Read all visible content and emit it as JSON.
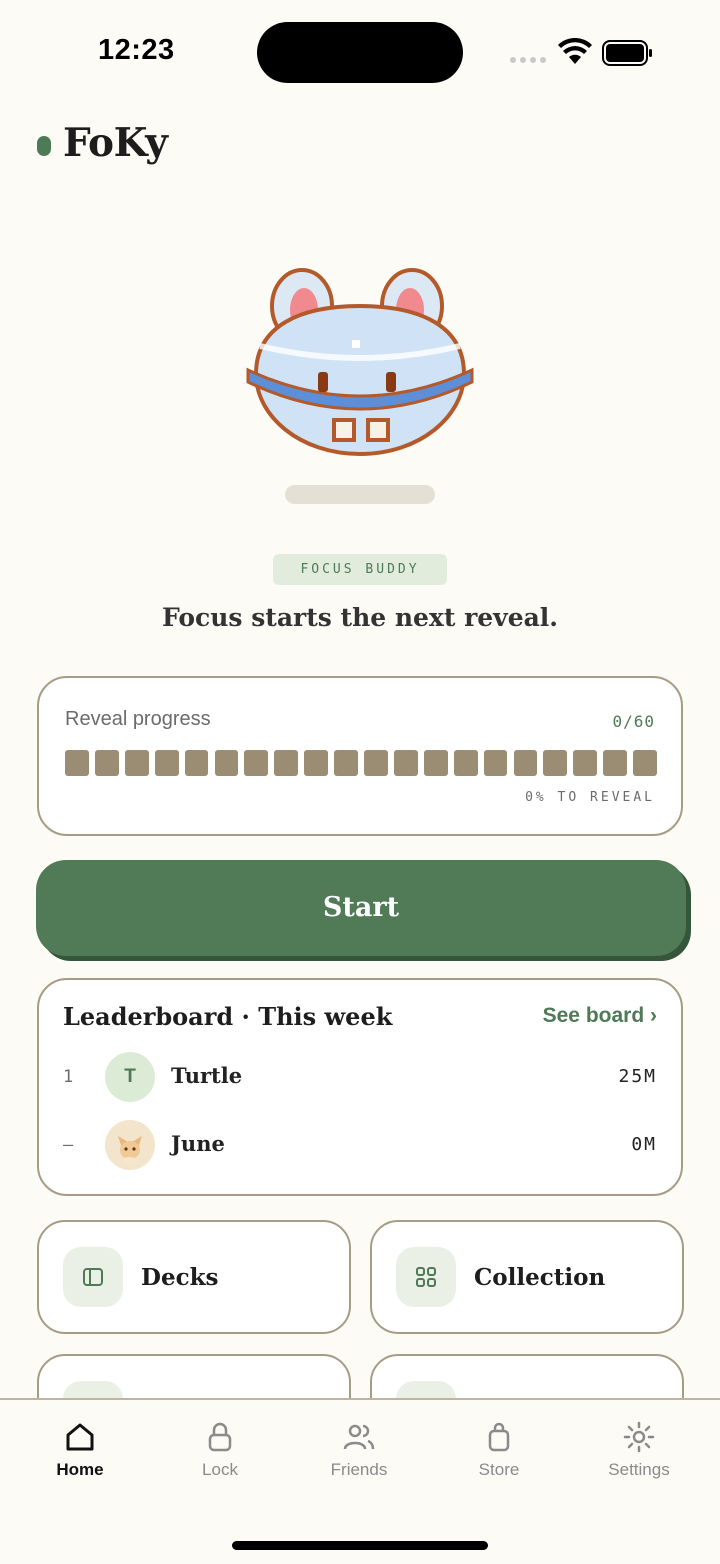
{
  "status_bar": {
    "time": "12:23"
  },
  "header": {
    "app_title": "FoKy"
  },
  "buddy": {
    "tag": "FOCUS BUDDY",
    "message": "Focus starts the next reveal."
  },
  "progress": {
    "label": "Reveal progress",
    "count": "0/60",
    "footer": "0% TO REVEAL",
    "segments_total": 20,
    "segments_filled": 0,
    "colors": {
      "empty": "#9A8D73"
    }
  },
  "start_button": {
    "label": "Start"
  },
  "leaderboard": {
    "title": "Leaderboard · This week",
    "link": "See board ›",
    "rows": [
      {
        "rank": "1",
        "avatar_letter": "T",
        "name": "Turtle",
        "minutes": "25M"
      },
      {
        "rank": "–",
        "avatar_letter": "",
        "name": "June",
        "minutes": "0M"
      }
    ]
  },
  "tiles": [
    {
      "label": "Decks",
      "icon": "deck-icon"
    },
    {
      "label": "Collection",
      "icon": "grid-icon"
    }
  ],
  "tab_bar": {
    "tabs": [
      {
        "label": "Home",
        "icon": "home-icon",
        "active": true
      },
      {
        "label": "Lock",
        "icon": "lock-icon",
        "active": false
      },
      {
        "label": "Friends",
        "icon": "friends-icon",
        "active": false
      },
      {
        "label": "Store",
        "icon": "bag-icon",
        "active": false
      },
      {
        "label": "Settings",
        "icon": "sun-settings-icon",
        "active": false
      }
    ]
  },
  "colors": {
    "accent": "#517B56",
    "background": "#FCFBF5",
    "border": "#A69C86"
  }
}
